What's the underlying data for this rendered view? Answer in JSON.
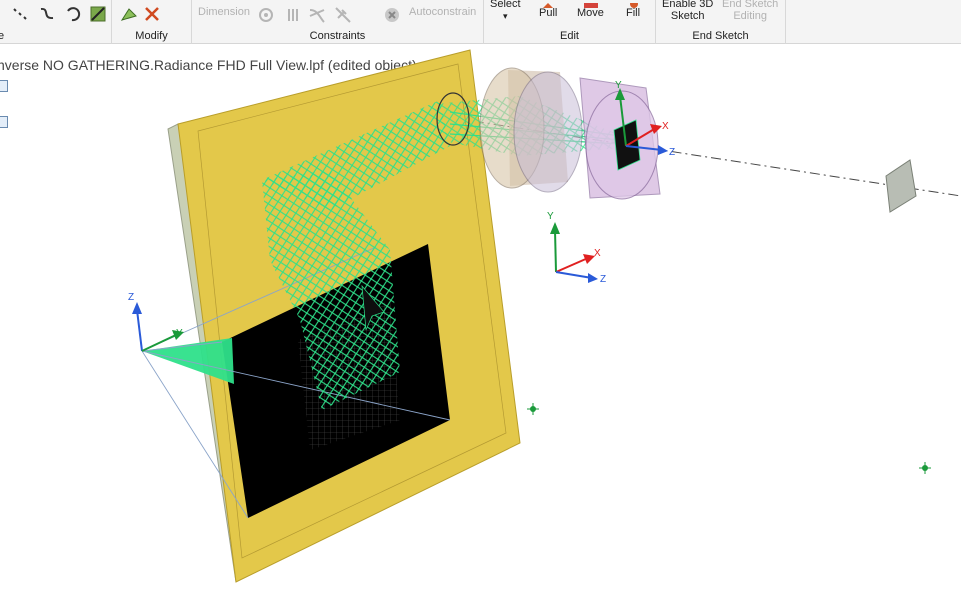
{
  "ribbon": {
    "groups": [
      {
        "label": "e"
      },
      {
        "label": "Modify"
      },
      {
        "label": "Constraints"
      },
      {
        "label": "Edit"
      },
      {
        "label": "End Sketch"
      }
    ],
    "constraints": {
      "dimension_label": "Dimension",
      "autoconstrain_label": "Autoconstrain"
    },
    "edit": {
      "select_label": "Select",
      "select_arrow": "▾",
      "pull_label": "Pull",
      "move_label": "Move",
      "fill_label": "Fill"
    },
    "end_sketch": {
      "enable3d_line1": "Enable 3D",
      "enable3d_line2": "Sketch",
      "end_edit_line1": "End Sketch",
      "end_edit_line2": "Editing"
    }
  },
  "viewport": {
    "document_title": "nverse NO GATHERING.Radiance FHD Full View.lpf (edited object)",
    "axes": {
      "left": {
        "z": "Z",
        "y": "Y"
      },
      "middle": {
        "y": "Y",
        "x": "X",
        "z": "Z"
      },
      "lens": {
        "y": "Y",
        "x": "X",
        "z": "Z"
      }
    }
  },
  "colors": {
    "panel": "#e3c84a",
    "panel_edge": "#c9d0b5",
    "rays": "#2ee08a",
    "screen": "#000000",
    "lens_barrel": "#c9a8d8",
    "axis_x": "#e02020",
    "axis_y": "#1a9a3a",
    "axis_z": "#2a5ad8"
  }
}
